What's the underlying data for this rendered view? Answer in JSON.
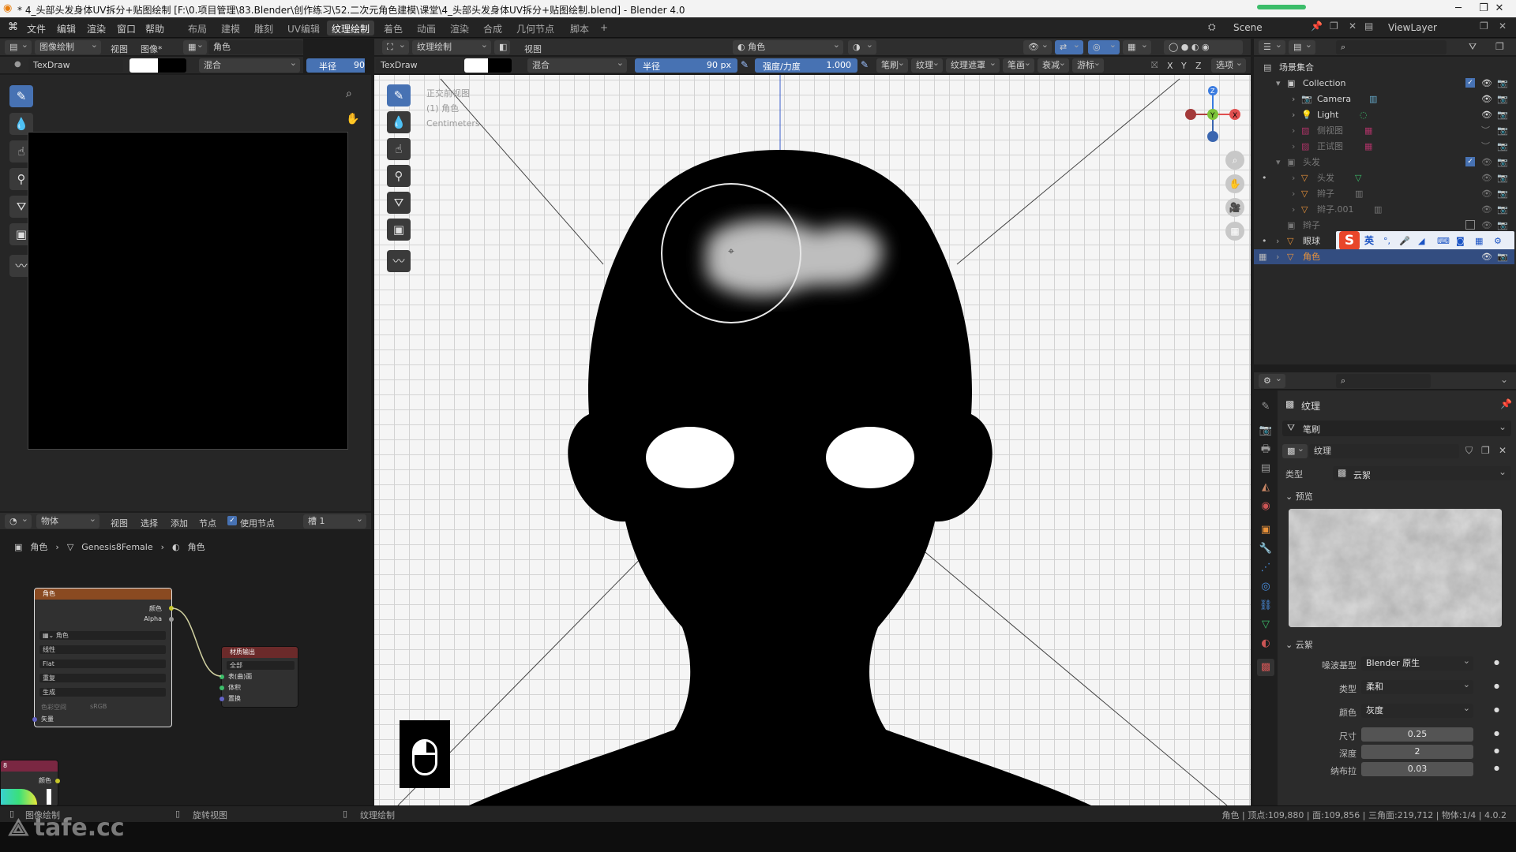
{
  "window": {
    "title": "* 4_头部头发身体UV拆分+贴图绘制 [F:\\0.项目管理\\83.Blender\\创作练习\\52.二次元角色建模\\课堂\\4_头部头发身体UV拆分+贴图绘制.blend] - Blender 4.0",
    "minimize": "─",
    "maximize": "❐",
    "close": "✕"
  },
  "menubar": {
    "menus": [
      "文件",
      "编辑",
      "渲染",
      "窗口",
      "帮助"
    ],
    "workspaces": [
      "布局",
      "建模",
      "雕刻",
      "UV编辑",
      "纹理绘制",
      "着色",
      "动画",
      "渲染",
      "合成",
      "几何节点",
      "脚本"
    ],
    "active_workspace": "纹理绘制",
    "add_workspace": "+",
    "scene_label": "Scene",
    "viewlayer_label": "ViewLayer"
  },
  "image_editor": {
    "mode": "图像绘制",
    "menus": [
      "视图",
      "图像*"
    ],
    "image_name": "角色",
    "brush_name": "TexDraw",
    "blend": "混合",
    "radius_label": "半径",
    "radius_value": "90"
  },
  "viewport": {
    "mode": "纹理绘制",
    "view_menu": "视图",
    "material": "角色",
    "brush_name": "TexDraw",
    "blend": "混合",
    "radius_label": "半径",
    "radius_value": "90 px",
    "strength_label": "强度/力度",
    "strength_value": "1.000",
    "panels": [
      "笔刷",
      "纹理",
      "纹理遮罩",
      "笔画",
      "衰减",
      "游标"
    ],
    "axes": [
      "X",
      "Y",
      "Z"
    ],
    "options": "选项",
    "overlay_lines": [
      "正交前视图",
      "(1) 角色",
      "Centimeters"
    ]
  },
  "node_editor": {
    "object_menu": "物体",
    "menus": [
      "视图",
      "选择",
      "添加",
      "节点"
    ],
    "use_nodes": "使用节点",
    "slot": "槽 1",
    "breadcrumb": [
      "角色",
      "Genesis8Female",
      "角色"
    ],
    "image_node": {
      "title": "角色",
      "outputs": [
        "颜色",
        "Alpha"
      ],
      "image": "角色",
      "interpolation": "线性",
      "projection": "Flat",
      "extension": "重复",
      "source": "生成",
      "colorspace_label": "色彩空间",
      "colorspace_value": "sRGB",
      "vector": "矢量"
    },
    "output_node": {
      "title": "材质输出",
      "target": "全部",
      "inputs": [
        "表(曲)面",
        "体积",
        "置换"
      ]
    },
    "color_node": {
      "title": "8",
      "output": "颜色"
    }
  },
  "outliner": {
    "root": "场景集合",
    "rows": [
      {
        "name": "Collection",
        "level": 1
      },
      {
        "name": "Camera",
        "level": 2
      },
      {
        "name": "Light",
        "level": 2
      },
      {
        "name": "侧视图",
        "level": 2
      },
      {
        "name": "正试图",
        "level": 2
      },
      {
        "name": "头发",
        "level": 1
      },
      {
        "name": "头发",
        "level": 2
      },
      {
        "name": "辫子",
        "level": 2
      },
      {
        "name": "辫子.001",
        "level": 2
      },
      {
        "name": "辫子",
        "level": 1
      },
      {
        "name": "眼球",
        "level": 1
      },
      {
        "name": "角色",
        "level": 1
      }
    ],
    "ime_label": "英"
  },
  "properties": {
    "tab_title": "纹理",
    "brush_label": "笔刷",
    "texture_name": "纹理",
    "type_label": "类型",
    "type_value": "云絮",
    "preview_label": "预览",
    "clouds_label": "云絮",
    "noise_basis_label": "噪波基型",
    "noise_basis_value": "Blender 原生",
    "noise_type_label": "类型",
    "noise_type_value": "柔和",
    "color_label": "颜色",
    "color_value": "灰度",
    "size_label": "尺寸",
    "size_value": "0.25",
    "depth_label": "深度",
    "depth_value": "2",
    "nabla_label": "纳布拉",
    "nabla_value": "0.03"
  },
  "statusbar": {
    "left": "图像绘制",
    "middle": "旋转视图",
    "right": "纹理绘制",
    "stats": "角色 | 顶点:109,880 | 面:109,856 | 三角面:219,712 | 物体:1/4 | 4.0.2"
  },
  "watermark": "tafe.cc",
  "colors": {
    "accent": "#4772b3",
    "orange": "#e9923a",
    "node_header_image": "#8a4a21",
    "node_header_output": "#6b2a2a"
  }
}
